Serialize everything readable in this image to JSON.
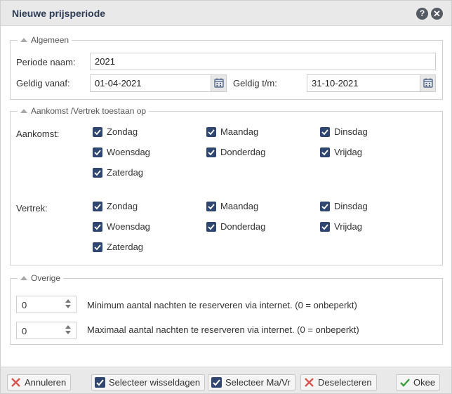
{
  "dialog": {
    "title": "Nieuwe prijsperiode",
    "help_icon_glyph": "?",
    "close_icon_glyph": "✕"
  },
  "general": {
    "legend": "Algemeen",
    "period_name_label": "Periode naam:",
    "period_name_value": "2021",
    "valid_from_label": "Geldig vanaf:",
    "valid_from_value": "01-04-2021",
    "valid_to_label": "Geldig t/m:",
    "valid_to_value": "31-10-2021"
  },
  "arrival_departure": {
    "legend": "Aankomst /Vertrek toestaan op",
    "arrival_label": "Aankomst:",
    "departure_label": "Vertrek:",
    "days": [
      "Zondag",
      "Maandag",
      "Dinsdag",
      "Woensdag",
      "Donderdag",
      "Vrijdag",
      "Zaterdag"
    ],
    "arrival_checked": [
      true,
      true,
      true,
      true,
      true,
      true,
      true
    ],
    "departure_checked": [
      true,
      true,
      true,
      true,
      true,
      true,
      true
    ]
  },
  "other": {
    "legend": "Overige",
    "min_nights_value": "0",
    "min_nights_label": "Minimum aantal nachten te reserveren via internet. (0 = onbeperkt)",
    "max_nights_value": "0",
    "max_nights_label": "Maximaal aantal nachten te reserveren via internet. (0 = onbeperkt)"
  },
  "footer": {
    "cancel_label": "Annuleren",
    "select_changeover_label": "Selecteer wisseldagen",
    "select_mon_fri_label": "Selecteer Ma/Vr",
    "deselect_label": "Deselecteren",
    "ok_label": "Okee"
  },
  "colors": {
    "accent": "#2f4670",
    "title_text": "#2e3d55",
    "cancel_icon": "#d9534f",
    "ok_icon": "#3e9e3e"
  }
}
